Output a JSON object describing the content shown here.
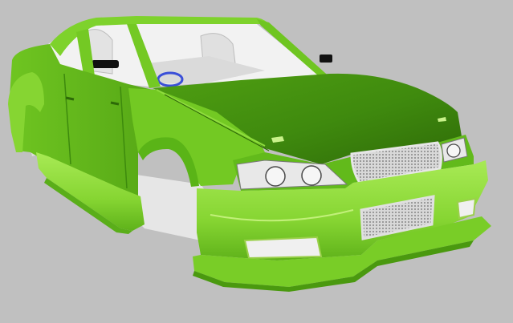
{
  "viewport": {
    "background": "#c0c0c0",
    "colors": {
      "body_light": "#9be042",
      "body_mid": "#6cc41e",
      "body_dark": "#3f8a0e",
      "body_shadow": "#2f6b08",
      "interior": "#f2f2f2",
      "interior_shadow": "#cfcfcf",
      "steering_wheel": "#3a4fd8",
      "lamp_chrome": "#e8e8e8",
      "grille": "#bdbdbd"
    },
    "model": "car-body-shell"
  }
}
